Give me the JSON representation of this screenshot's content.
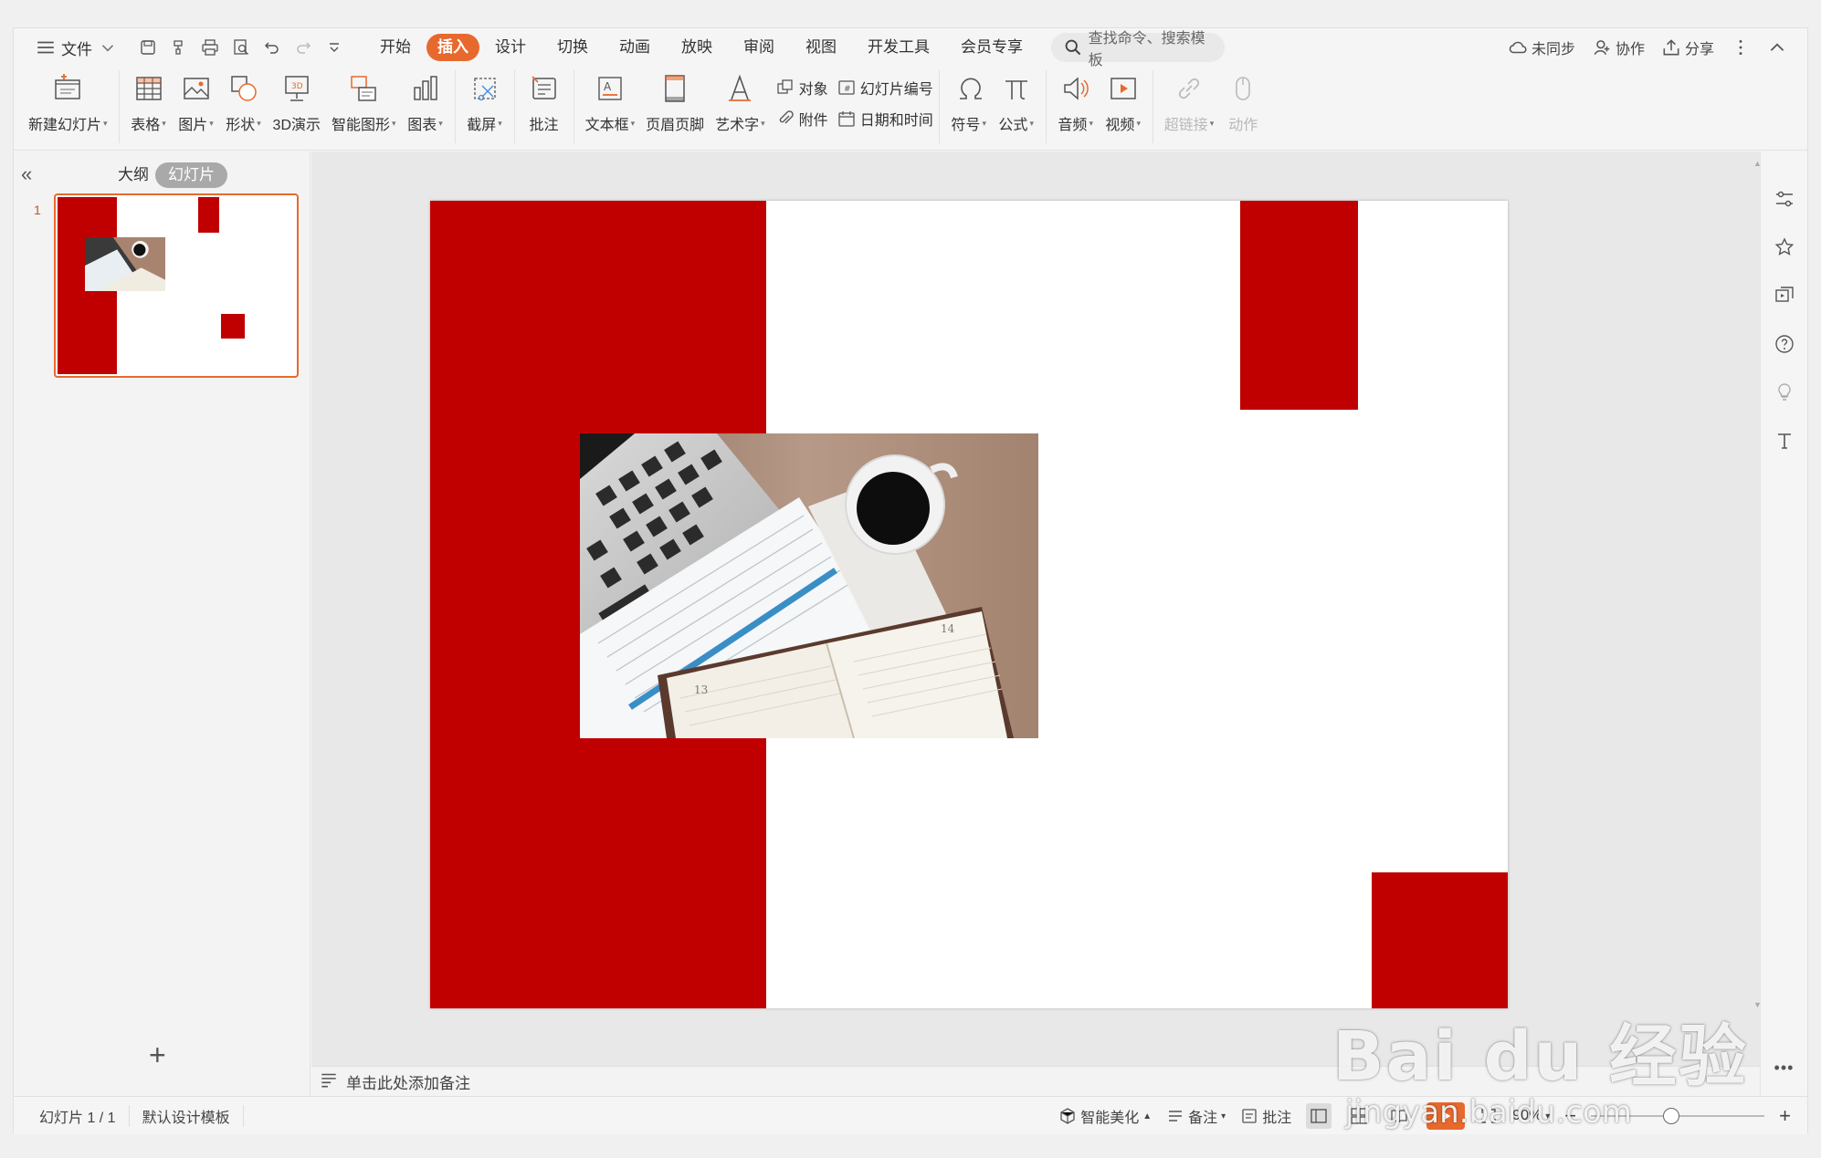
{
  "menu": {
    "file": "文件",
    "tabs": [
      "开始",
      "插入",
      "设计",
      "切换",
      "动画",
      "放映",
      "审阅",
      "视图",
      "开发工具",
      "会员专享"
    ],
    "active_tab": "插入",
    "search_placeholder": "查找命令、搜索模板",
    "right": {
      "sync": "未同步",
      "collab": "协作",
      "share": "分享"
    }
  },
  "ribbon": {
    "new_slide": "新建幻灯片",
    "table": "表格",
    "picture": "图片",
    "shape": "形状",
    "demo3d": "3D演示",
    "smartart": "智能图形",
    "chart": "图表",
    "screenshot": "截屏",
    "comment": "批注",
    "textbox": "文本框",
    "header_footer": "页眉页脚",
    "wordart": "艺术字",
    "object": "对象",
    "attachment": "附件",
    "slide_number": "幻灯片编号",
    "datetime": "日期和时间",
    "symbol": "符号",
    "formula": "公式",
    "audio": "音频",
    "video": "视频",
    "hyperlink": "超链接",
    "action": "动作"
  },
  "left_panel": {
    "outline_tab": "大纲",
    "slides_tab": "幻灯片",
    "thumb_number": "1"
  },
  "notes_placeholder": "单击此处添加备注",
  "status": {
    "slide_count": "幻灯片 1 / 1",
    "template": "默认设计模板",
    "beautify": "智能美化",
    "notes": "备注",
    "comment": "批注",
    "zoom": "90%"
  },
  "colors": {
    "accent": "#e8692d",
    "slide_red": "#c00000"
  },
  "watermark": {
    "brand": "Bai du 经验",
    "url": "jingyan.baidu.com"
  }
}
